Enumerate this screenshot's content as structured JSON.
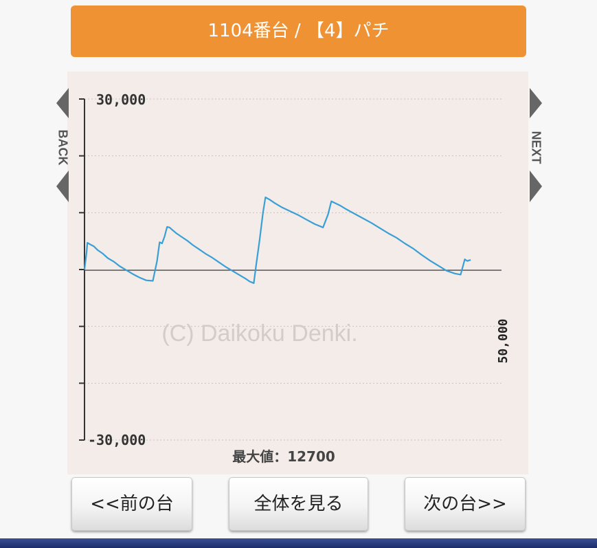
{
  "header": {
    "title": "1104番台 / 【4】パチ"
  },
  "nav": {
    "back_label": "BACK",
    "next_label": "NEXT"
  },
  "chart_data": {
    "type": "line",
    "y_axis": {
      "max_label": "30,000",
      "min_label": "-30,000",
      "ylim": [
        -30000,
        30000
      ],
      "gridline_step": 10000
    },
    "x_axis": {
      "max_label": "50,000",
      "xlim": [
        0,
        50000
      ]
    },
    "watermark": "(C) Daikoku Denki.",
    "max_value_label": "最大値：12700",
    "grid": true,
    "series": [
      {
        "color": "#3a9fd5",
        "x": [
          0,
          250,
          350,
          700,
          1100,
          1600,
          2200,
          2800,
          3500,
          4200,
          5000,
          5800,
          6600,
          7400,
          8200,
          8700,
          9000,
          9300,
          9600,
          9900,
          10200,
          10500,
          11000,
          11600,
          12300,
          13000,
          13700,
          14500,
          15300,
          16100,
          16900,
          17700,
          18500,
          19300,
          19800,
          20300,
          20600,
          21000,
          21400,
          21700,
          22200,
          22800,
          23600,
          24600,
          25600,
          26600,
          27600,
          28600,
          29200,
          29600,
          29900,
          30600,
          31400,
          32400,
          33400,
          34400,
          35400,
          36400,
          37400,
          38400,
          39400,
          40400,
          41400,
          42400,
          43400,
          44400,
          45100,
          45600,
          45900,
          46300
        ],
        "y": [
          0,
          3000,
          4700,
          4400,
          4100,
          3400,
          2800,
          2000,
          1400,
          600,
          -100,
          -800,
          -1400,
          -1900,
          -2000,
          1500,
          4800,
          4600,
          5800,
          7500,
          7400,
          7000,
          6400,
          5800,
          5100,
          4300,
          3600,
          2800,
          2100,
          1300,
          500,
          -200,
          -900,
          -1600,
          -2100,
          -2400,
          1000,
          5200,
          10000,
          12700,
          12300,
          11700,
          11000,
          10300,
          9600,
          8800,
          8000,
          7400,
          9700,
          12000,
          11800,
          11300,
          10600,
          9800,
          9000,
          8200,
          7300,
          6400,
          5600,
          4600,
          3700,
          2600,
          1600,
          700,
          -200,
          -700,
          -900,
          1800,
          1500,
          1700
        ]
      }
    ]
  }
}
